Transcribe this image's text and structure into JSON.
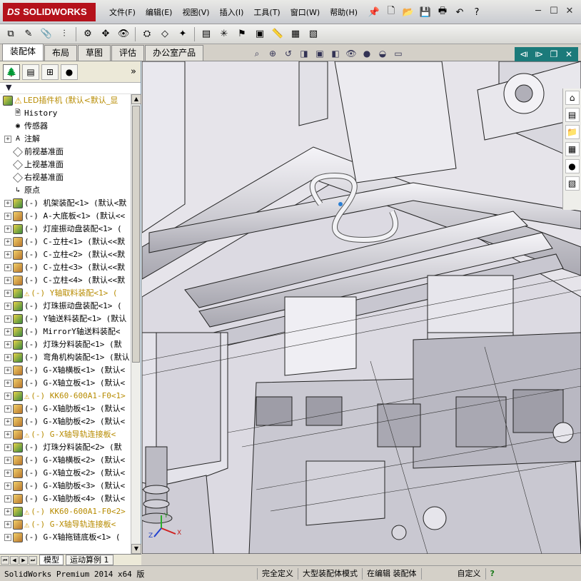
{
  "app": {
    "logo_text": "SOLIDWORKS",
    "logo_prefix": "DS"
  },
  "menu": [
    "文件(F)",
    "编辑(E)",
    "视图(V)",
    "插入(I)",
    "工具(T)",
    "窗口(W)",
    "帮助(H)"
  ],
  "command_tabs": [
    "装配体",
    "布局",
    "草图",
    "评估",
    "办公室产品"
  ],
  "feature_tree": {
    "root": {
      "label": "LED插件机",
      "config": "(默认<默认_显"
    },
    "nodes": [
      {
        "label": "History",
        "icon": "history-icon",
        "expand": false
      },
      {
        "label": "传感器",
        "icon": "sensor-icon",
        "expand": false
      },
      {
        "label": "注解",
        "icon": "annotation-icon",
        "expand": true
      },
      {
        "label": "前视基准面",
        "icon": "plane-icon",
        "expand": false
      },
      {
        "label": "上视基准面",
        "icon": "plane-icon",
        "expand": false
      },
      {
        "label": "右视基准面",
        "icon": "plane-icon",
        "expand": false
      },
      {
        "label": "原点",
        "icon": "origin-icon",
        "expand": false
      },
      {
        "label": "(-) 机架装配<1> (默认<默",
        "icon": "assembly-icon",
        "expand": true
      },
      {
        "label": "(-) A-大底板<1> (默认<<",
        "icon": "part-icon",
        "expand": true
      },
      {
        "label": "(-) 灯座振动盘装配<1> (",
        "icon": "assembly-icon",
        "expand": true
      },
      {
        "label": "(-) C-立柱<1> (默认<<默",
        "icon": "part-icon",
        "expand": true
      },
      {
        "label": "(-) C-立柱<2> (默认<<默",
        "icon": "part-icon",
        "expand": true
      },
      {
        "label": "(-) C-立柱<3> (默认<<默",
        "icon": "part-icon",
        "expand": true
      },
      {
        "label": "(-) C-立柱<4> (默认<<默",
        "icon": "part-icon",
        "expand": true
      },
      {
        "label": "(-) Y轴取料装配<1> (",
        "icon": "assembly-icon",
        "expand": true,
        "warn": true
      },
      {
        "label": "(-) 灯珠振动盘装配<1> (",
        "icon": "assembly-icon",
        "expand": true
      },
      {
        "label": "(-) Y轴送料装配<1> (默认",
        "icon": "assembly-icon",
        "expand": true
      },
      {
        "label": "(-) MirrorY轴送料装配<",
        "icon": "assembly-icon",
        "expand": true
      },
      {
        "label": "(-) 灯珠分料装配<1> (默",
        "icon": "assembly-icon",
        "expand": true
      },
      {
        "label": "(-) 弯角机构装配<1> (默认",
        "icon": "assembly-icon",
        "expand": true
      },
      {
        "label": "(-) G-X轴横板<1> (默认<",
        "icon": "part-icon",
        "expand": true
      },
      {
        "label": "(-) G-X轴立板<1> (默认<",
        "icon": "part-icon",
        "expand": true
      },
      {
        "label": "(-) KK60-600A1-F0<1>",
        "icon": "assembly-icon",
        "expand": true,
        "warn": true
      },
      {
        "label": "(-) G-X轴肋板<1> (默认<",
        "icon": "part-icon",
        "expand": true
      },
      {
        "label": "(-) G-X轴肋板<2> (默认<",
        "icon": "part-icon",
        "expand": true
      },
      {
        "label": "(-) G-X轴导轨连接板<",
        "icon": "part-icon",
        "expand": true,
        "warn": true
      },
      {
        "label": "(-) 灯珠分料装配<2> (默",
        "icon": "assembly-icon",
        "expand": true
      },
      {
        "label": "(-) G-X轴横板<2> (默认<",
        "icon": "part-icon",
        "expand": true
      },
      {
        "label": "(-) G-X轴立板<2> (默认<",
        "icon": "part-icon",
        "expand": true
      },
      {
        "label": "(-) G-X轴肋板<3> (默认<",
        "icon": "part-icon",
        "expand": true
      },
      {
        "label": "(-) G-X轴肋板<4> (默认<",
        "icon": "part-icon",
        "expand": true
      },
      {
        "label": "(-) KK60-600A1-F0<2>",
        "icon": "assembly-icon",
        "expand": true,
        "warn": true
      },
      {
        "label": "(-) G-X轴导轨连接板<",
        "icon": "part-icon",
        "expand": true,
        "warn": true
      },
      {
        "label": "(-) G-X轴拖链底板<1> (",
        "icon": "part-icon",
        "expand": true
      }
    ]
  },
  "bottom_tabs": [
    "模型",
    "运动算例 1"
  ],
  "status": {
    "product": "SolidWorks Premium 2014 x64 版",
    "defined": "完全定义",
    "mode": "大型装配体模式",
    "editing": "在编辑 装配体",
    "units": "自定义"
  },
  "triad": {
    "x": "X",
    "y": "Y",
    "z": "Z"
  }
}
